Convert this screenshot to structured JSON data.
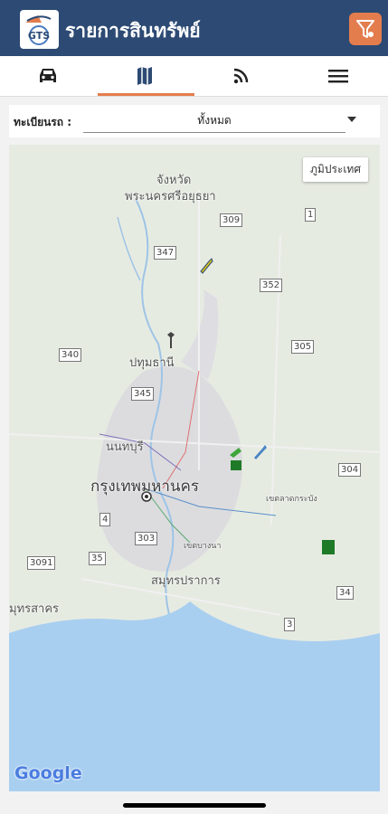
{
  "header": {
    "title": "รายการสินทรัพย์",
    "logo_text": "GTS"
  },
  "tabs": [
    {
      "icon": "car-icon"
    },
    {
      "icon": "map-icon",
      "active": true
    },
    {
      "icon": "rss-icon"
    },
    {
      "icon": "menu-icon"
    }
  ],
  "filter": {
    "label": "ทะเบียนรถ :",
    "selected": "ทั้งหมด"
  },
  "map": {
    "terrain_button": "ภูมิประเทศ",
    "labels": {
      "ayutthaya_1": "จังหวัด",
      "ayutthaya_2": "พระนครศรีอยุธยา",
      "pathum_thani": "ปทุมธานี",
      "nonthaburi": "นนทบุรี",
      "bangkok": "กรุงเทพมหานคร",
      "lat_krabang": "เขตลาดกระบัง",
      "bang_na": "เขตบางนา",
      "samut_prakan": "สมุทรปราการ",
      "samut_sakhon": "มุทรสาคร"
    },
    "shields": {
      "r309": "309",
      "r1": "1",
      "r347": "347",
      "r352": "352",
      "r340": "340",
      "r305": "305",
      "r345": "345",
      "r304": "304",
      "r4": "4",
      "r303": "303",
      "r3091": "3091",
      "r35": "35",
      "r34": "34",
      "r3": "3"
    },
    "attribution": "Google"
  },
  "colors": {
    "header_bg": "#2c4a73",
    "accent": "#e37d4e",
    "water": "#a9cff0",
    "land": "#e6ebe2"
  }
}
